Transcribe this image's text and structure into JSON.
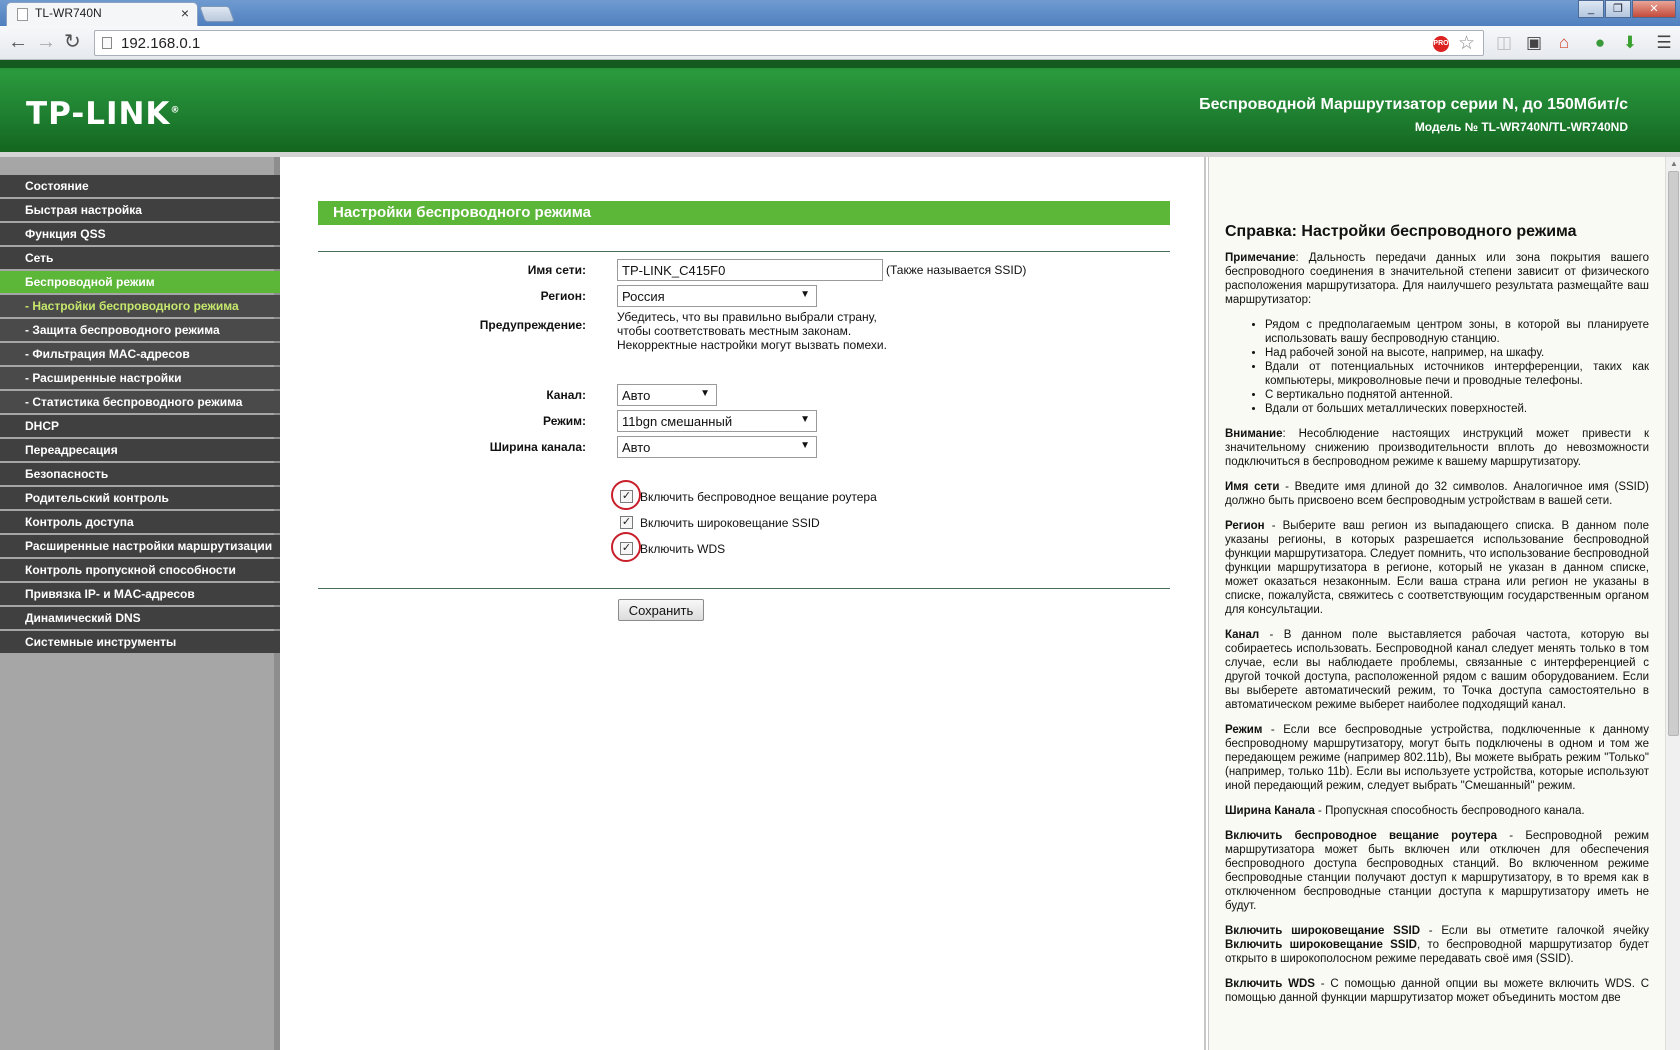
{
  "browser": {
    "tab_title": "TL-WR740N",
    "tab_close": "×",
    "url": "192.168.0.1",
    "pro_badge": "PRO",
    "window_buttons": [
      "_",
      "❐",
      "✕"
    ]
  },
  "header": {
    "logo": "TP-LINK",
    "title": "Беспроводной Маршрутизатор серии N, до 150Мбит/с",
    "model": "Модель № TL-WR740N/TL-WR740ND"
  },
  "sidebar": {
    "items": [
      {
        "label": "Состояние"
      },
      {
        "label": "Быстрая настройка"
      },
      {
        "label": "Функция QSS"
      },
      {
        "label": "Сеть"
      },
      {
        "label": "Беспроводной режим"
      },
      {
        "label": "- Настройки беспроводного режима"
      },
      {
        "label": "- Защита беспроводного режима"
      },
      {
        "label": "- Фильтрация MAC-адресов"
      },
      {
        "label": "- Расширенные настройки"
      },
      {
        "label": "- Статистика беспроводного режима"
      },
      {
        "label": "DHCP"
      },
      {
        "label": "Переадресация"
      },
      {
        "label": "Безопасность"
      },
      {
        "label": "Родительский контроль"
      },
      {
        "label": "Контроль доступа"
      },
      {
        "label": "Расширенные настройки маршрутизации"
      },
      {
        "label": "Контроль пропускной способности"
      },
      {
        "label": "Привязка IP- и MAC-адресов"
      },
      {
        "label": "Динамический DNS"
      },
      {
        "label": "Системные инструменты"
      }
    ]
  },
  "main": {
    "section_title": "Настройки беспроводного режима",
    "ssid_label": "Имя сети:",
    "ssid_value": "TP-LINK_C415F0",
    "ssid_note": "(Также называется SSID)",
    "region_label": "Регион:",
    "region_value": "Россия",
    "warning_label": "Предупреждение:",
    "warning_lines": [
      "Убедитесь, что вы правильно выбрали страну,",
      "чтобы соответствовать местным законам.",
      "Некорректные настройки могут вызвать помехи."
    ],
    "channel_label": "Канал:",
    "channel_value": "Авто",
    "mode_label": "Режим:",
    "mode_value": "11bgn смешанный",
    "width_label": "Ширина канала:",
    "width_value": "Авто",
    "cb_broadcast": "Включить беспроводное вещание роутера",
    "cb_ssid": "Включить широковещание SSID",
    "cb_wds": "Включить WDS",
    "check_mark": "✓",
    "save": "Сохранить"
  },
  "help": {
    "title": "Справка: Настройки беспроводного режима",
    "note_b": "Примечание",
    "note_t": ": Дальность передачи данных или зона покрытия вашего беспроводного соединения в значительной степени зависит от физического расположения маршрутизатора. Для наилучшего результата размещайте ваш маршрутизатор:",
    "bullets": [
      "Рядом с предполагаемым центром зоны, в которой вы планируете использовать вашу беспроводную станцию.",
      "Над рабочей зоной на высоте, например, на шкафу.",
      "Вдали от потенциальных источников интерференции, таких как компьютеры, микроволновые печи и проводные телефоны.",
      "С вертикально поднятой антенной.",
      "Вдали от больших металлических поверхностей."
    ],
    "attn_b": "Внимание",
    "attn_t": ": Несоблюдение настоящих инструкций может привести к значительному снижению производительности вплоть до невозможности подключиться в беспроводном режиме к вашему маршрутизатору.",
    "ssid_b": "Имя сети",
    "ssid_t": " - Введите имя длиной до 32 символов. Аналогичное имя (SSID) должно быть присвоено всем беспроводным устройствам в вашей сети.",
    "region_b": "Регион",
    "region_t": " - Выберите ваш регион из выпадающего списка. В данном поле указаны регионы, в которых разрешается использование беспроводной функции маршрутизатора. Следует помнить, что использование беспроводной функции маршрутизатора в регионе, который не указан в данном списке, может оказаться незаконным. Если ваша страна или регион не указаны в списке, пожалуйста, свяжитесь с соответствующим государственным органом для консультации.",
    "channel_b": "Канал",
    "channel_t": " - В данном поле выставляется рабочая частота, которую вы собираетесь использовать. Беспроводной канал следует менять только в том случае, если вы наблюдаете проблемы, связанные с интерференцией с другой точкой доступа, расположенной рядом с вашим оборудованием. Если вы выберете автоматический режим, то Точка доступа самостоятельно в автоматическом режиме выберет наиболее подходящий канал.",
    "mode_b": "Режим",
    "mode_t": " - Если все беспроводные устройства, подключенные к данному беспроводному маршрутизатору, могут быть подключены в одном и том же передающем режиме (например 802.11b), Вы можете выбрать режим \"Только\" (например, только 11b). Если вы используете устройства, которые используют иной передающий режим, следует выбрать \"Смешанный\" режим.",
    "width_b": "Ширина Канала",
    "width_t": " - Пропускная способность беспроводного канала.",
    "bcast_b": "Включить беспроводное вещание роутера",
    "bcast_t": " - Беспроводной режим маршрутизатора может быть включен или отключен для обеспечения беспроводного доступа беспроводных станций. Во включенном режиме беспроводные станции получают доступ к маршрутизатору, в то время как в отключенном беспроводные станции доступа к маршрутизатору иметь не будут.",
    "ssidb_b": "Включить широковещание SSID",
    "ssidb_t1": " - Если вы отметите галочкой ячейку ",
    "ssidb_b2": "Включить широковещание SSID",
    "ssidb_t2": ", то беспроводной маршрутизатор будет открыто в широкополосном режиме передавать своё имя (SSID).",
    "wds_b": "Включить WDS",
    "wds_t": " - С помощью данной опции вы можете включить WDS. С помощью данной функции маршрутизатор может объединить мостом две"
  }
}
